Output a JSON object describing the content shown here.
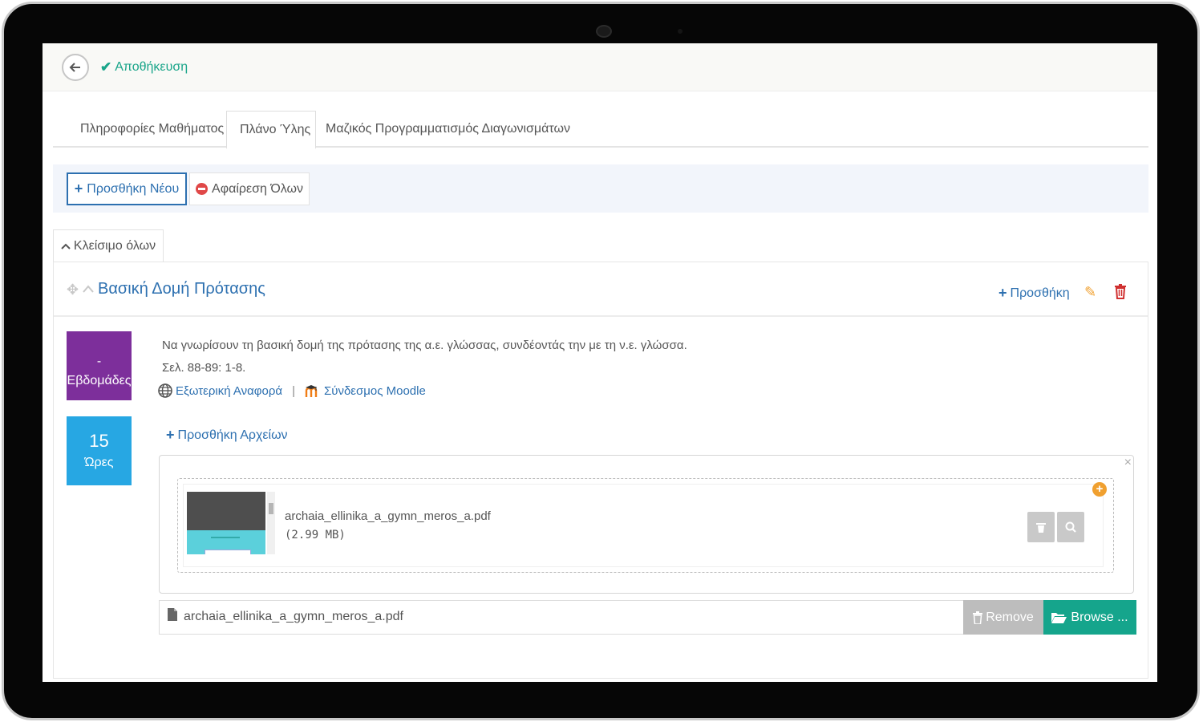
{
  "topbar": {
    "save_label": "Αποθήκευση"
  },
  "tabs": [
    {
      "label": "Πληροφορίες Μαθήματος"
    },
    {
      "label": "Πλάνο Ύλης"
    },
    {
      "label": "Μαζικός Προγραμματισμός Διαγωνισμάτων"
    }
  ],
  "active_tab": "Πλάνο Ύλης",
  "actions": {
    "add_new": "Προσθήκη Νέου",
    "remove_all": "Αφαίρεση Όλων"
  },
  "collapse_all": "Κλείσιμο όλων",
  "unit": {
    "title": "Βασική Δομή Πρότασης",
    "add_label": "Προσθήκη",
    "week_dash": "-",
    "week_label": "Εβδομάδες",
    "hours_value": "15",
    "hours_label": "Ώρες",
    "description": "Να γνωρίσουν τη βασική δομή της πρότασης της α.ε. γλώσσας, συνδέοντάς την με τη ν.ε. γλώσσα.",
    "pages": "Σελ. 88-89: 1-8.",
    "external_ref": "Εξωτερική Αναφορά",
    "separator": "|",
    "moodle_link": "Σύνδεσμος Moodle",
    "add_files": "Προσθήκη Αρχείων"
  },
  "upload": {
    "close_glyph": "×",
    "preview_file_name": "archaia_ellinika_a_gymn_meros_a.pdf",
    "preview_file_size": "(2.99 MB)",
    "selected_file": "archaia_ellinika_a_gymn_meros_a.pdf",
    "remove_label": "Remove",
    "browse_label": "Browse ..."
  },
  "colors": {
    "primary": "#2d70b0",
    "success": "#19a589",
    "week_box": "#7d2f9b",
    "hours_box": "#27a7e3",
    "danger": "#e04848",
    "warning": "#f0a030"
  },
  "icons": [
    "back-arrow-icon",
    "check-icon",
    "plus-icon",
    "minus-circle-icon",
    "chevron-up-icon",
    "move-icon",
    "pencil-icon",
    "trash-icon",
    "globe-icon",
    "moodle-icon",
    "close-icon",
    "plus-circle-icon",
    "zoom-icon",
    "file-icon",
    "folder-open-icon"
  ]
}
